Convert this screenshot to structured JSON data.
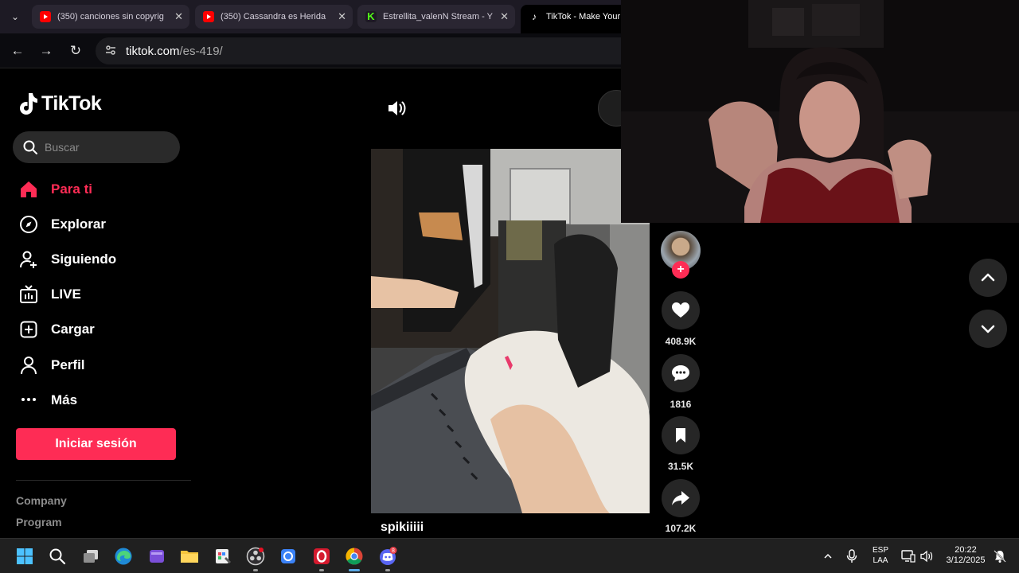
{
  "browser": {
    "tabs": [
      {
        "title": "(350) canciones sin copyrig",
        "favicon": "youtube-icon"
      },
      {
        "title": "(350) Cassandra es Herida",
        "favicon": "youtube-icon"
      },
      {
        "title": "Estrellita_valenN Stream - Y",
        "favicon": "kick-icon"
      },
      {
        "title": "TikTok - Make Your",
        "favicon": "tiktok-icon"
      }
    ],
    "url_host": "tiktok.com",
    "url_path": "/es-419/"
  },
  "sidebar": {
    "brand": "TikTok",
    "search_placeholder": "Buscar",
    "nav": [
      {
        "label": "Para ti",
        "icon": "home-icon",
        "active": true
      },
      {
        "label": "Explorar",
        "icon": "compass-icon"
      },
      {
        "label": "Siguiendo",
        "icon": "following-icon"
      },
      {
        "label": "LIVE",
        "icon": "live-tv-icon"
      },
      {
        "label": "Cargar",
        "icon": "upload-icon"
      },
      {
        "label": "Perfil",
        "icon": "profile-icon"
      },
      {
        "label": "Más",
        "icon": "more-icon"
      }
    ],
    "login_label": "Iniciar sesión",
    "footer_links": [
      "Company",
      "Program"
    ]
  },
  "video": {
    "username": "spikiiiii",
    "likes": "408.9K",
    "comments": "1816",
    "saves": "31.5K",
    "shares": "107.2K"
  },
  "taskbar": {
    "lang_top": "ESP",
    "lang_bottom": "LAA",
    "time": "20:22",
    "date": "3/12/2025",
    "discord_badge": "8"
  },
  "colors": {
    "accent": "#fe2c55",
    "background": "#000000",
    "taskbar": "#202020"
  }
}
